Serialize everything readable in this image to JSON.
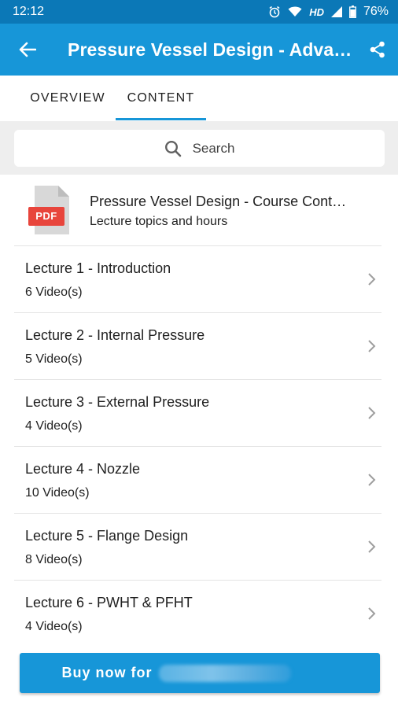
{
  "status_bar": {
    "time": "12:12",
    "network_label": "HD",
    "battery": "76%"
  },
  "app_bar": {
    "title": "Pressure Vessel Design - Advan…",
    "back_icon": "arrow-left",
    "share_icon": "share"
  },
  "tabs": [
    {
      "label": "OVERVIEW",
      "selected": false
    },
    {
      "label": "CONTENT",
      "selected": true
    }
  ],
  "search": {
    "placeholder": "Search"
  },
  "pdf_item": {
    "badge": "PDF",
    "title": "Pressure Vessel Design - Course Cont…",
    "subtitle": "Lecture topics and hours"
  },
  "lectures": [
    {
      "title": "Lecture 1 - Introduction",
      "subtitle": "6 Video(s)"
    },
    {
      "title": "Lecture 2 - Internal Pressure",
      "subtitle": "5 Video(s)"
    },
    {
      "title": "Lecture 3 - External Pressure",
      "subtitle": "4 Video(s)"
    },
    {
      "title": "Lecture 4 - Nozzle",
      "subtitle": "10 Video(s)"
    },
    {
      "title": "Lecture 5 - Flange Design",
      "subtitle": "8 Video(s)"
    },
    {
      "title": "Lecture 6 - PWHT & PFHT",
      "subtitle": "4 Video(s)"
    }
  ],
  "buy_button": {
    "label": "Buy now for"
  },
  "colors": {
    "status_bar": "#0b78b7",
    "app_bar": "#1796d8",
    "accent": "#1796d8",
    "pdf_badge": "#e8453c"
  }
}
